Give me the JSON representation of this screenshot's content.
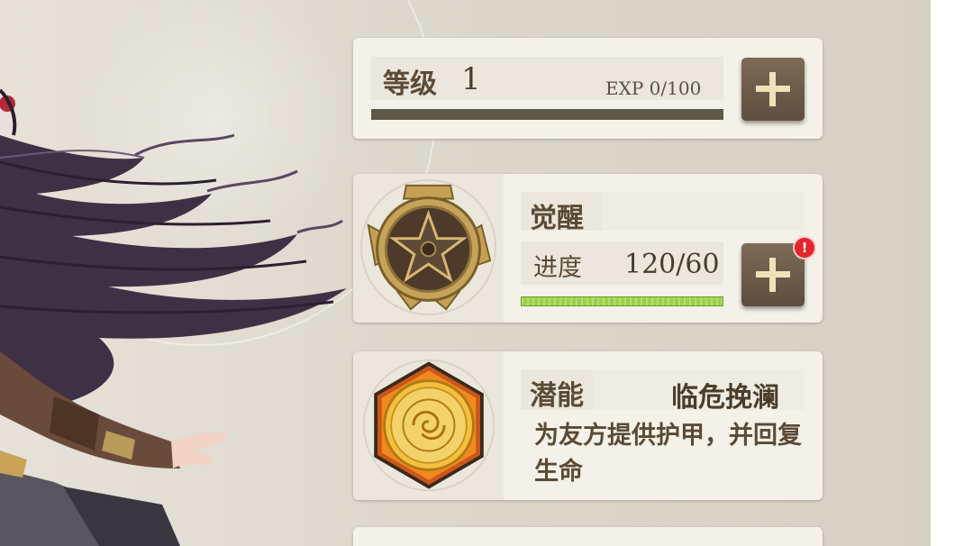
{
  "level": {
    "label": "等级",
    "value": "1",
    "exp_text": "EXP 0/100",
    "exp_progress": 0
  },
  "awakening": {
    "title": "觉醒",
    "progress_label": "进度",
    "progress_value": "120/60",
    "progress_fraction": 1.0,
    "alert_badge": "!"
  },
  "potential": {
    "title": "潜能",
    "skill_name": "临危挽澜",
    "description": "为友方提供护甲，并回复生命"
  },
  "icons": {
    "level_plus": "plus-icon",
    "awaken_plus": "plus-icon",
    "awaken_emblem": "star-medallion-icon",
    "potential_emblem": "golden-coin-icon"
  },
  "colors": {
    "progress_green": "#9ad14a",
    "button_brown": "#6b5948",
    "alert_red": "#e2262a"
  }
}
